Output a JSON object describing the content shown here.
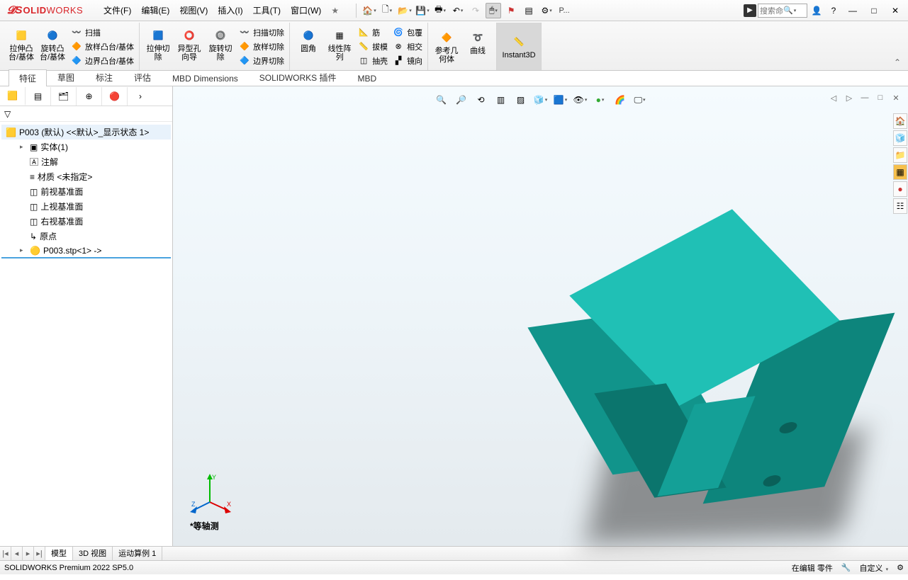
{
  "app": {
    "brand1": "S",
    "brand2": "OLID",
    "brand3": "WORKS"
  },
  "menu": {
    "file": "文件(F)",
    "edit": "编辑(E)",
    "view": "视图(V)",
    "insert": "插入(I)",
    "tools": "工具(T)",
    "window": "窗口(W)",
    "star": "★"
  },
  "search": {
    "placeholder": "搜索命",
    "p_label": "P..."
  },
  "ribbon": {
    "g1": {
      "extrude": "拉伸凸\n台/基体",
      "revolve": "旋转凸\n台/基体",
      "sweep": "扫描",
      "loft": "放样凸台/基体",
      "boundary": "边界凸台/基体"
    },
    "g2": {
      "cutext": "拉伸切\n除",
      "hole": "异型孔\n向导",
      "cutrev": "旋转切\n除",
      "cutsweep": "扫描切除",
      "cutloft": "放样切除",
      "cutbound": "边界切除"
    },
    "g3": {
      "fillet": "圆角",
      "linpat": "线性阵\n列",
      "rib": "筋",
      "draft": "拔模",
      "shell": "抽壳",
      "wrap": "包覆",
      "intersect": "相交",
      "mirror": "镜向"
    },
    "g4": {
      "refgeo": "参考几\n何体",
      "curve": "曲线",
      "instant": "Instant3D"
    }
  },
  "tabs": {
    "feat": "特征",
    "sketch": "草图",
    "annot": "标注",
    "eval": "评估",
    "mbd": "MBD Dimensions",
    "addins": "SOLIDWORKS 插件",
    "mbd2": "MBD"
  },
  "tree": {
    "root": "P003 (默认) <<默认>_显示状态 1>",
    "solid": "实体(1)",
    "annot": "注解",
    "material": "材质 <未指定>",
    "front": "前视基准面",
    "top": "上视基准面",
    "right": "右视基准面",
    "origin": "原点",
    "import": "P003.stp<1> ->"
  },
  "viewport": {
    "label": "*等轴测",
    "axes": {
      "x": "X",
      "y": "Y",
      "z": "Z"
    }
  },
  "bottomTabs": {
    "model": "模型",
    "view3d": "3D 视图",
    "motion": "运动算例 1"
  },
  "status": {
    "version": "SOLIDWORKS Premium 2022 SP5.0",
    "editing": "在编辑 零件",
    "custom": "自定义"
  }
}
